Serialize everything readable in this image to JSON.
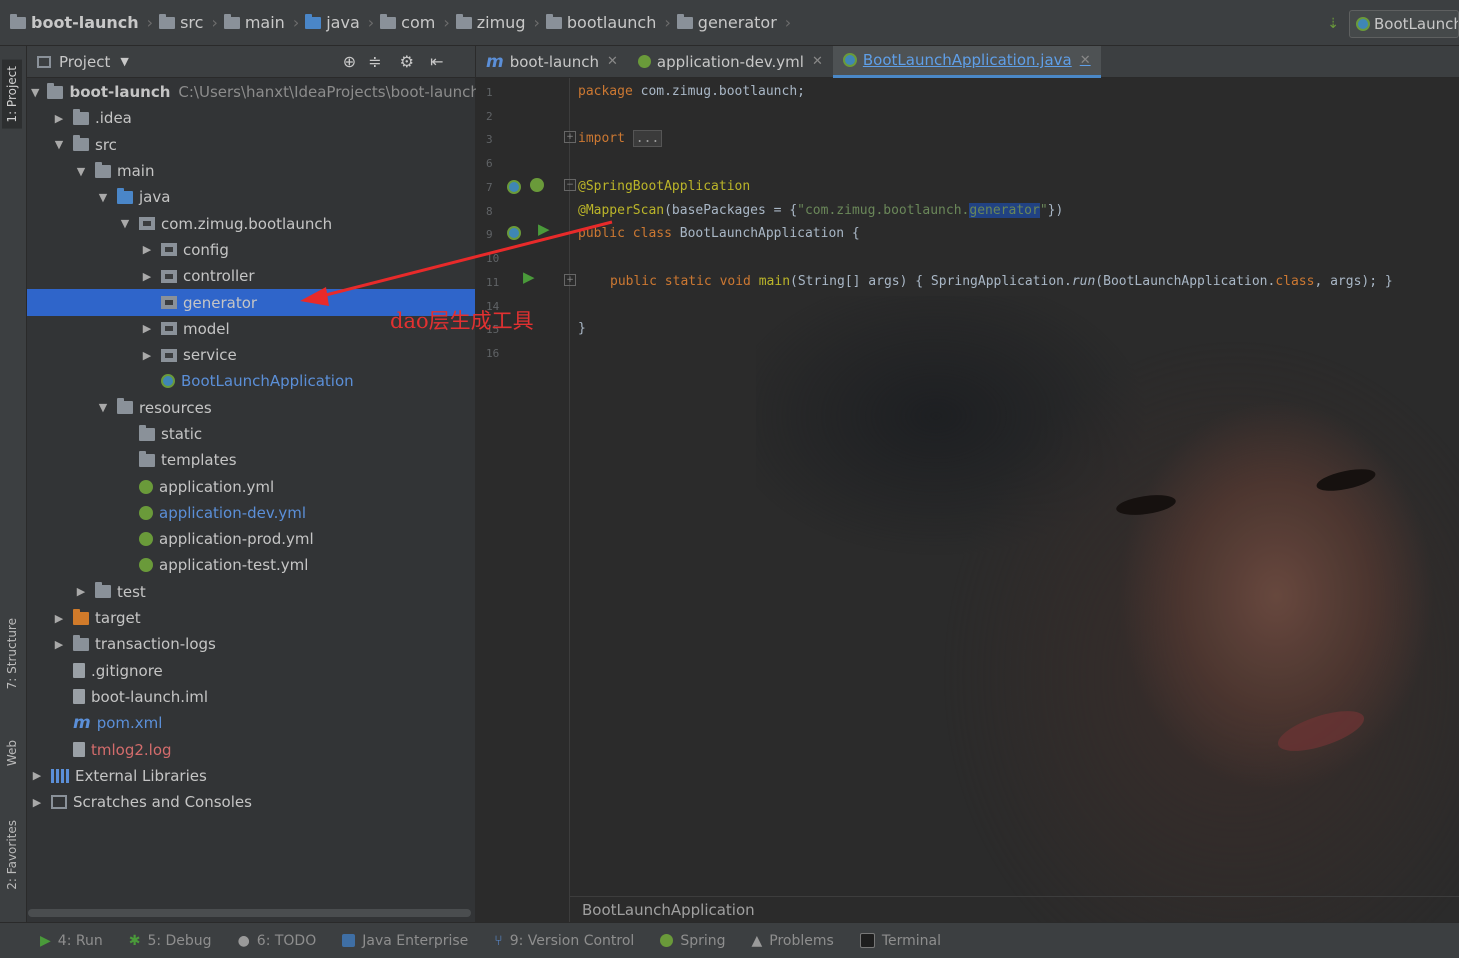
{
  "breadcrumb": {
    "items": [
      "boot-launch",
      "src",
      "main",
      "java",
      "com",
      "zimug",
      "bootlaunch",
      "generator"
    ],
    "run_config": "BootLaunchApplication"
  },
  "side_tabs": {
    "project": "1: Project",
    "structure": "7: Structure",
    "web": "Web",
    "favorites": "2: Favorites"
  },
  "project_panel": {
    "title": "Project",
    "root": {
      "name": "boot-launch",
      "path": "C:\\Users\\hanxt\\IdeaProjects\\boot-launch"
    },
    "items": [
      ".idea",
      "src",
      "main",
      "java",
      "com.zimug.bootlaunch",
      "config",
      "controller",
      "generator",
      "model",
      "service",
      "BootLaunchApplication",
      "resources",
      "static",
      "templates",
      "application.yml",
      "application-dev.yml",
      "application-prod.yml",
      "application-test.yml",
      "test",
      "target",
      "transaction-logs",
      ".gitignore",
      "boot-launch.iml",
      "pom.xml",
      "tmlog2.log",
      "External Libraries",
      "Scratches and Consoles"
    ]
  },
  "editor": {
    "tabs": [
      "boot-launch",
      "application-dev.yml",
      "BootLaunchApplication.java"
    ],
    "line_numbers": [
      "1",
      "2",
      "3",
      "6",
      "7",
      "8",
      "9",
      "10",
      "11",
      "14",
      "15",
      "16"
    ],
    "code": {
      "l1_kw": "package",
      "l1_rest": " com.zimug.bootlaunch;",
      "l3_kw": "import",
      "l3_fold": "...",
      "l7": "@SpringBootApplication",
      "l8_ann": "@MapperScan",
      "l8_a": "(basePackages = {",
      "l8_str1": "\"com.",
      "l8_str2": "zimug",
      "l8_str3": ".",
      "l8_str4": "bootlaunch",
      "l8_str5": ".",
      "l8_hl": "generator",
      "l8_str6": "\"",
      "l8_b": "})",
      "l9_kw": "public class",
      "l9_rest": " BootLaunchApplication {",
      "l11_kw": "public static void",
      "l11_main": " main",
      "l11_a": "(String[] args) ",
      "l11_b": "{ SpringApplication.",
      "l11_run": "run",
      "l11_c": "(BootLaunchApplication.",
      "l11_class": "class",
      "l11_d": ", args); }",
      "l15": "}"
    },
    "breadcrumb": "BootLaunchApplication"
  },
  "annotation": "dao层生成工具",
  "bottom_tabs": [
    "4: Run",
    "5: Debug",
    "6: TODO",
    "Java Enterprise",
    "9: Version Control",
    "Spring",
    "Problems",
    "Terminal"
  ],
  "colors": {
    "selection": "#2f65ca",
    "annotation_red": "#e23131",
    "keyword": "#cc7832",
    "annotation_yellow": "#bbb529"
  }
}
